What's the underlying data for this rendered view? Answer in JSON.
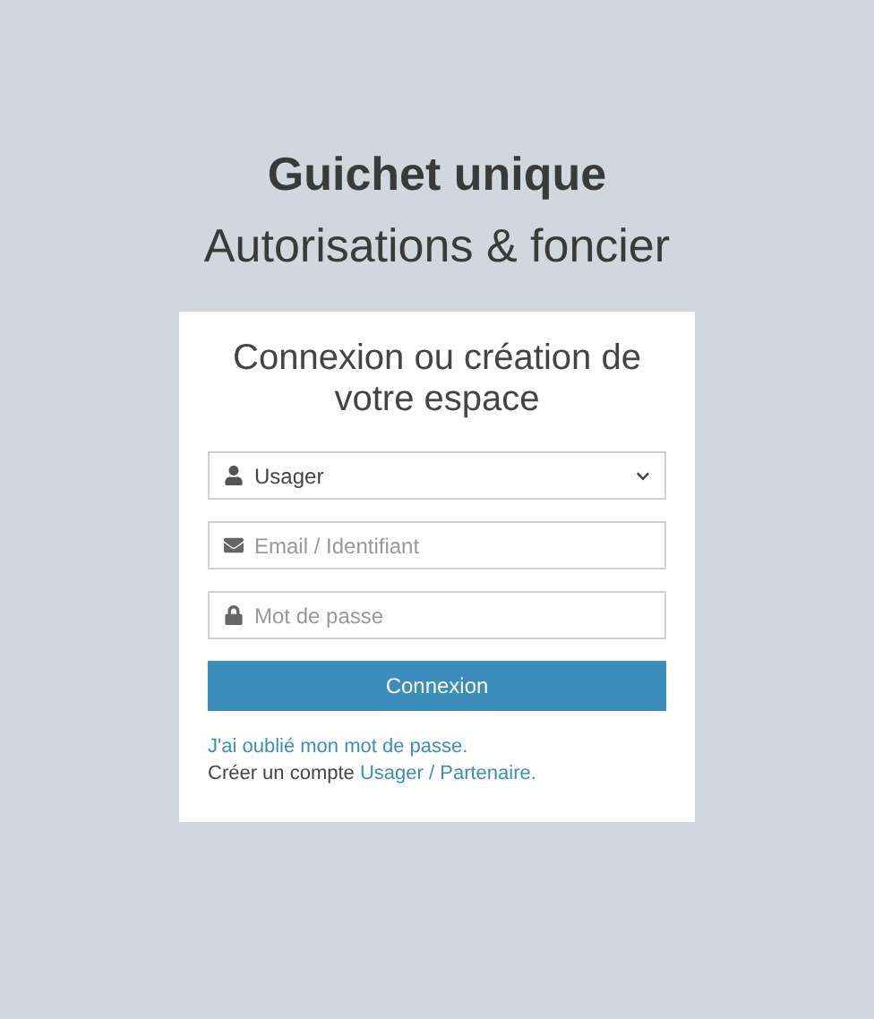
{
  "header": {
    "title": "Guichet unique",
    "subtitle": "Autorisations & foncier"
  },
  "card": {
    "heading": "Connexion ou création de votre espace",
    "account_type": {
      "value": "Usager"
    },
    "email": {
      "placeholder": "Email / Identifiant"
    },
    "password": {
      "placeholder": "Mot de passe"
    },
    "submit": "Connexion",
    "forgot_link": "J'ai oublié mon mot de passe.",
    "signup_text": "Créer un compte ",
    "signup_link": "Usager / Partenaire."
  }
}
